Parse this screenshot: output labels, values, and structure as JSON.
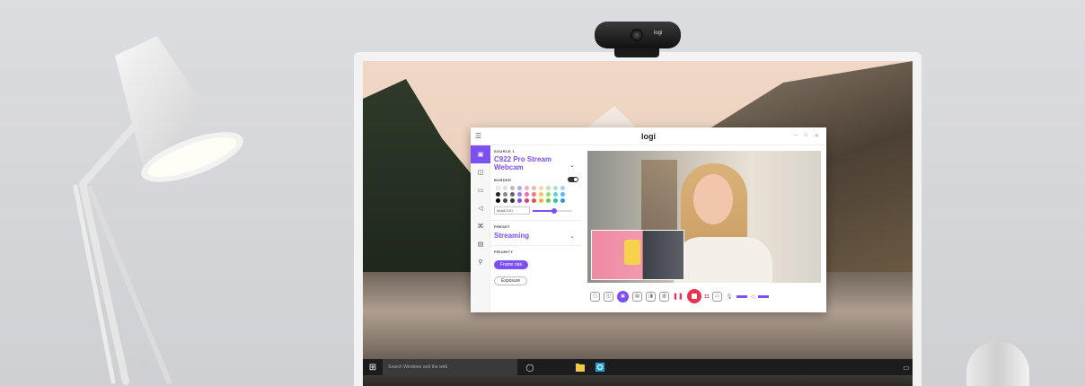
{
  "webcam": {
    "logo": "logi"
  },
  "app": {
    "title": "logi",
    "window_controls": [
      "–",
      "□",
      "✕"
    ],
    "rail_icons": [
      "source-icon",
      "layout-icon",
      "camera-icon",
      "audio-icon",
      "filter-icon",
      "overlay-icon",
      "account-icon"
    ],
    "panel": {
      "source_label": "SOURCE 1",
      "source_name": "C922 Pro Stream Webcam",
      "border_label": "BORDER",
      "hex_value": "#6A6CDD",
      "preset_label": "PRESET",
      "preset_value": "Streaming",
      "priority_label": "PRIORITY",
      "priority_options": [
        "Frame rate",
        "Exposure"
      ],
      "priority_selected": "Frame rate",
      "border_slider_level": 0.55
    },
    "swatch_colors": [
      "#ffffff",
      "#dddddd",
      "#bbbbbb",
      "#b7a3f0",
      "#f6a8c8",
      "#f7b4b4",
      "#f6d79a",
      "#c2e8a0",
      "#9ee6e1",
      "#9cd3f5",
      "#222222",
      "#888888",
      "#666666",
      "#9b7bea",
      "#ec6fa4",
      "#ef7c7c",
      "#f3c66b",
      "#9ddb6f",
      "#5fd6cf",
      "#5bb7ee",
      "#000000",
      "#444444",
      "#333333",
      "#7b4ff0",
      "#e0357e",
      "#e84c4c",
      "#f0b03c",
      "#6cc93f",
      "#24c3b8",
      "#2199e2"
    ]
  },
  "taskbar": {
    "search_placeholder": "Search Windows and the web"
  },
  "colors": {
    "accent": "#7b4ff0",
    "record": "#e8344e"
  }
}
